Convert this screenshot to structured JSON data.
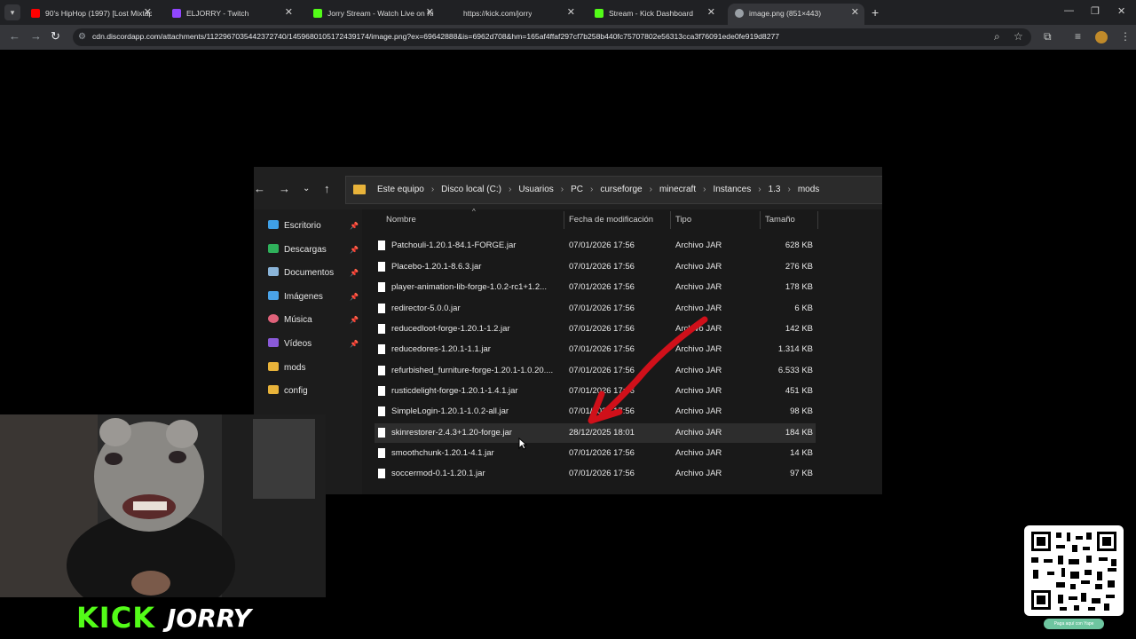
{
  "browser": {
    "tabs": [
      {
        "label": "90's HipHop (1997) [Lost Mixtap",
        "favicon": "youtube-icon",
        "color": "#ff0000"
      },
      {
        "label": "ELJORRY - Twitch",
        "favicon": "twitch-icon",
        "color": "#9146ff"
      },
      {
        "label": "Jorry Stream - Watch Live on Ki",
        "favicon": "kick-icon",
        "color": "#53fc18"
      },
      {
        "label": "https://kick.com/jorry",
        "favicon": "",
        "color": ""
      },
      {
        "label": "Stream - Kick Dashboard",
        "favicon": "kick-icon",
        "color": "#53fc18"
      },
      {
        "label": "image.png (851×443)",
        "favicon": "globe-icon",
        "color": "#9aa0a6"
      }
    ],
    "url": "cdn.discordapp.com/attachments/1122967035442372740/1459680105172439174/image.png?ex=69642888&is=6962d708&hm=165af4ffaf297cf7b258b440fc75707802e56313cca3f76091ede0fe919d8277"
  },
  "explorer": {
    "breadcrumb": [
      "Este equipo",
      "Disco local (C:)",
      "Usuarios",
      "PC",
      "curseforge",
      "minecraft",
      "Instances",
      "1.3",
      "mods"
    ],
    "sidebar": [
      {
        "label": "Escritorio",
        "icon": "desktop-icon",
        "pinned": true
      },
      {
        "label": "Descargas",
        "icon": "download-icon",
        "pinned": true
      },
      {
        "label": "Documentos",
        "icon": "document-icon",
        "pinned": true
      },
      {
        "label": "Imágenes",
        "icon": "image-icon",
        "pinned": true
      },
      {
        "label": "Música",
        "icon": "music-icon",
        "pinned": true
      },
      {
        "label": "Vídeos",
        "icon": "video-icon",
        "pinned": true
      },
      {
        "label": "mods",
        "icon": "folder-icon",
        "pinned": false
      },
      {
        "label": "config",
        "icon": "folder-icon",
        "pinned": false
      }
    ],
    "columns": {
      "name": "Nombre",
      "date": "Fecha de modificación",
      "type": "Tipo",
      "size": "Tamaño"
    },
    "files": [
      {
        "name": "Patchouli-1.20.1-84.1-FORGE.jar",
        "date": "07/01/2026 17:56",
        "type": "Archivo JAR",
        "size": "628 KB"
      },
      {
        "name": "Placebo-1.20.1-8.6.3.jar",
        "date": "07/01/2026 17:56",
        "type": "Archivo JAR",
        "size": "276 KB"
      },
      {
        "name": "player-animation-lib-forge-1.0.2-rc1+1.2...",
        "date": "07/01/2026 17:56",
        "type": "Archivo JAR",
        "size": "178 KB"
      },
      {
        "name": "redirector-5.0.0.jar",
        "date": "07/01/2026 17:56",
        "type": "Archivo JAR",
        "size": "6 KB"
      },
      {
        "name": "reducedloot-forge-1.20.1-1.2.jar",
        "date": "07/01/2026 17:56",
        "type": "Archivo JAR",
        "size": "142 KB"
      },
      {
        "name": "reducedores-1.20.1-1.1.jar",
        "date": "07/01/2026 17:56",
        "type": "Archivo JAR",
        "size": "1.314 KB"
      },
      {
        "name": "refurbished_furniture-forge-1.20.1-1.0.20....",
        "date": "07/01/2026 17:56",
        "type": "Archivo JAR",
        "size": "6.533 KB"
      },
      {
        "name": "rusticdelight-forge-1.20.1-1.4.1.jar",
        "date": "07/01/2026 17:56",
        "type": "Archivo JAR",
        "size": "451 KB"
      },
      {
        "name": "SimpleLogin-1.20.1-1.0.2-all.jar",
        "date": "07/01/2026 17:56",
        "type": "Archivo JAR",
        "size": "98 KB"
      },
      {
        "name": "skinrestorer-2.4.3+1.20-forge.jar",
        "date": "28/12/2025 18:01",
        "type": "Archivo JAR",
        "size": "184 KB"
      },
      {
        "name": "smoothchunk-1.20.1-4.1.jar",
        "date": "07/01/2026 17:56",
        "type": "Archivo JAR",
        "size": "14 KB"
      },
      {
        "name": "soccermod-0.1-1.20.1.jar",
        "date": "07/01/2026 17:56",
        "type": "Archivo JAR",
        "size": "97 KB"
      }
    ]
  },
  "overlay": {
    "kick_logo": "KICK",
    "streamer": "JORRY",
    "qr_caption": "Paga aquí con Yape",
    "accent": "#53fc18",
    "arrow_color": "#d0101a"
  }
}
